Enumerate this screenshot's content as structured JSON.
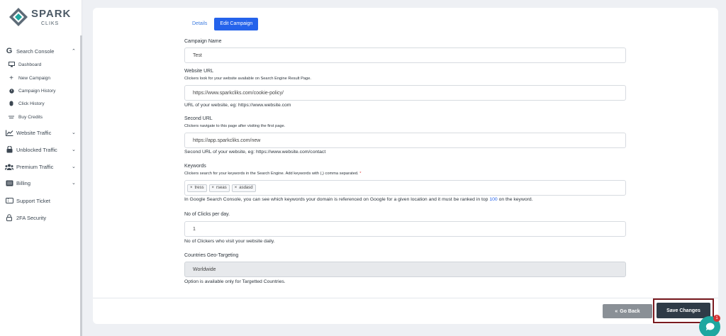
{
  "brand": {
    "title": "SPARK",
    "subtitle": "CLIKS",
    "colors": {
      "accent": "#2563eb",
      "logo": "#4c5a66",
      "chat": "#1fa7a0"
    }
  },
  "sidebar": {
    "sections": [
      {
        "label": "Search Console",
        "icon": "google-g-icon",
        "expanded": true
      },
      {
        "label": "Website Traffic",
        "icon": "line-chart-icon"
      },
      {
        "label": "Unblocked Traffic",
        "icon": "lock-icon"
      },
      {
        "label": "Premium Traffic",
        "icon": "users-icon"
      },
      {
        "label": "Billing",
        "icon": "billing-icon"
      }
    ],
    "search_console_items": [
      {
        "label": "Dashboard",
        "icon": "monitor-icon"
      },
      {
        "label": "New Campaign",
        "icon": "plus-icon"
      },
      {
        "label": "Campaign History",
        "icon": "history-icon"
      },
      {
        "label": "Click History",
        "icon": "mouse-icon"
      },
      {
        "label": "Buy Credits",
        "icon": "credits-icon"
      }
    ],
    "bottom_items": [
      {
        "label": "Support Ticket",
        "icon": "ticket-icon"
      },
      {
        "label": "2FA Security",
        "icon": "padlock-icon"
      }
    ]
  },
  "tabs": {
    "details": "Details",
    "edit": "Edit Campaign",
    "active": "Edit Campaign"
  },
  "form": {
    "campaign_name": {
      "label": "Campaign Name",
      "value": "Test"
    },
    "website_url": {
      "label": "Website URL",
      "help": "Clickers look for your website available on Search Engine Result Page.",
      "value": "https://www.sparkcliks.com/cookie-policy/",
      "note": "URL of your website, eg: https://www.website.com"
    },
    "second_url": {
      "label": "Second URL",
      "help": "Clickers navigate to this page after visiting the first page.",
      "value": "https://app.sparkcliks.com/new",
      "note": "Second URL of your website, eg: https://www.website.com/contact"
    },
    "keywords": {
      "label": "Keywords",
      "help": "Clickers search for your keywords in the Search Engine. Add keywords with (,) comma separated.",
      "required_mark": "*",
      "tags": [
        "tress",
        "rseas",
        "asdasd"
      ],
      "note_before": "In Google Search Console, you can see which keywords your domain is referenced on Google for a given location and it must be ranked in top ",
      "note_highlight": "100",
      "note_after": " on the keyword."
    },
    "clicks_per_day": {
      "label": "No of Clicks per day.",
      "value": "1",
      "note": "No of Clickers who visit your website daily."
    },
    "geo_targeting": {
      "label": "Countries Geo-Targeting",
      "value": "Worldwide",
      "note": "Option is available only for Targetted Countries."
    }
  },
  "footer": {
    "back_label": "Go Back",
    "save_label": "Save Changes"
  },
  "chat": {
    "badge": "1"
  }
}
